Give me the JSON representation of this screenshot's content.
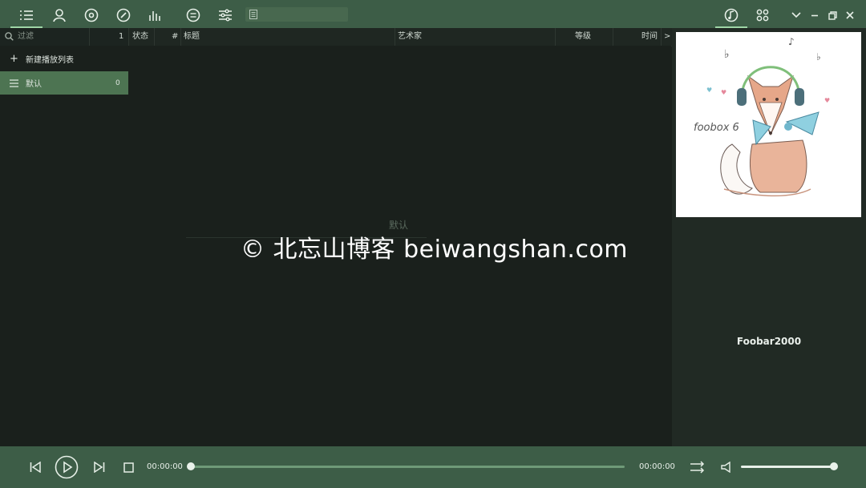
{
  "topbar": {
    "nav_icons": [
      "list-icon",
      "artist-icon",
      "album-icon",
      "dashboard-icon",
      "equalizer-icon",
      "lyrics-icon",
      "sliders-icon"
    ],
    "search": {
      "value": "",
      "placeholder": ""
    },
    "right_icons": [
      "music-note-icon",
      "grid-icon",
      "chevron-down-icon",
      "minimize-icon",
      "restore-icon",
      "close-icon"
    ]
  },
  "sidebar": {
    "filter_placeholder": "过滤",
    "filter_count": "1",
    "new_playlist_label": "新建播放列表",
    "playlists": [
      {
        "name": "默认",
        "count": "0",
        "active": true
      }
    ]
  },
  "columns": {
    "status": "状态",
    "number": "#",
    "title": "标题",
    "artist": "艺术家",
    "rating": "等级",
    "time": "时间",
    "more": ">"
  },
  "list": {
    "empty_title": "默认"
  },
  "right_panel": {
    "cover_text": "foobox 6",
    "track_name": "Foobar2000"
  },
  "player": {
    "elapsed": "00:00:00",
    "duration": "00:00:00",
    "progress": 0,
    "volume": 1.0
  },
  "watermark": "© 北忘山博客 beiwangshan.com",
  "colors": {
    "bar": "#3d5d47",
    "accent": "#4d7452",
    "background": "#1a201c"
  }
}
